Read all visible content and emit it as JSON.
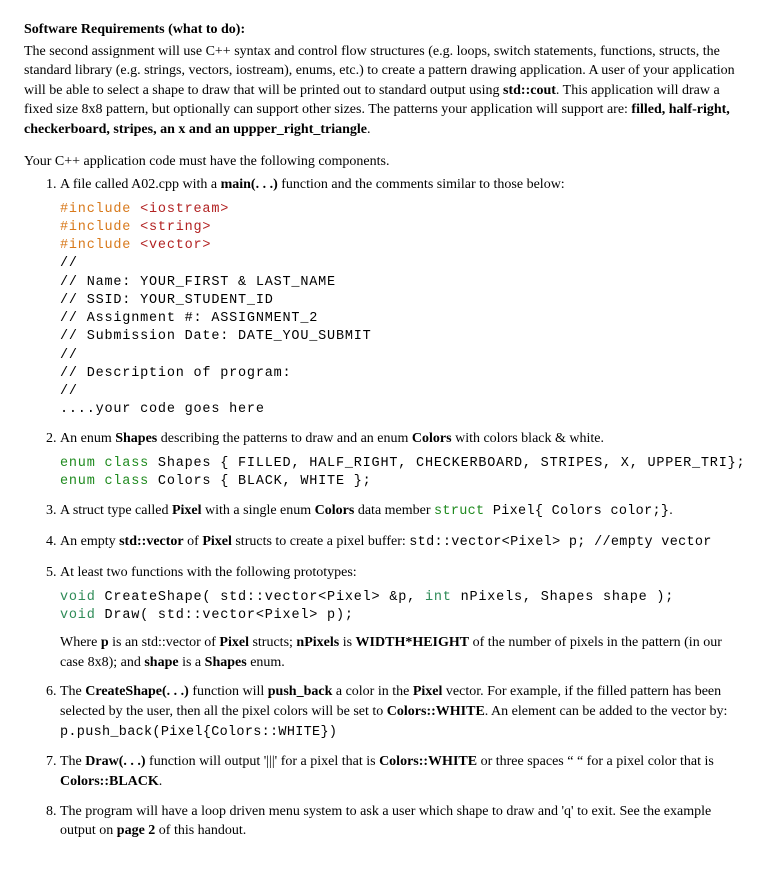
{
  "heading": "Software Requirements (what to do):",
  "intro_html": "The second assignment will use C++ syntax and control flow structures (e.g. loops, switch statements, functions, structs, the standard library (e.g. strings, vectors, iostream), enums, etc.) to create a pattern drawing application. A user of your application will be able to select a shape to draw that will be printed out to standard output using <b>std::cout</b>. This application will draw a fixed size 8x8 pattern, but optionally can support other sizes. The patterns your application will support are: <b>filled, half-right, checkerboard, stripes, an x and an uppper_right_triangle</b>.",
  "lead_in": "Your C++ application code must have the following components.",
  "item1_text_html": "A file called A02.cpp with a <b>main(. . .)</b> function and the comments similar to those below:",
  "code1_lines": {
    "l1a": "#include ",
    "l1b": "<iostream>",
    "l2a": "#include ",
    "l2b": "<string>",
    "l3a": "#include ",
    "l3b": "<vector>",
    "l4": "//",
    "l5": "// Name: YOUR_FIRST & LAST_NAME",
    "l6": "// SSID: YOUR_STUDENT_ID",
    "l7": "// Assignment #: ASSIGNMENT_2",
    "l8": "// Submission Date: DATE_YOU_SUBMIT",
    "l9": "//",
    "l10": "// Description of program:",
    "l11": "//",
    "l12": "....your code goes here"
  },
  "item2_text_html": "An enum <b>Shapes</b> describing the patterns to draw and an enum <b>Colors</b> with colors black &amp; white.",
  "code2_lines": {
    "kw1": "enum class ",
    "body1": "Shapes { FILLED, HALF_RIGHT, CHECKERBOARD, STRIPES, X, UPPER_TRI};",
    "kw2": "enum class ",
    "body2": "Colors { BLACK, WHITE };"
  },
  "item3_text_html": "A struct type called <b>Pixel</b> with a single enum <b>Colors</b> data member <span class='inline-code'><span class='kw-type'>struct</span> Pixel{ Colors color;}</span>.",
  "item4_text_html": "An empty <b>std::vector</b> of <b>Pixel</b> structs to create a pixel buffer: <span class='inline-code'>std::vector&lt;Pixel&gt; p; //empty vector</span>",
  "item5_text_html": "At least two functions with the following prototypes:",
  "code5_lines": {
    "v1": "void ",
    "l1": "CreateShape( std::vector<Pixel> &p, ",
    "i1": "int ",
    "l1b": "nPixels, Shapes shape );",
    "v2": "void ",
    "l2": "Draw( std::vector<Pixel> p);"
  },
  "item5_note_html": "Where <b>p</b> is an std::vector of <b>Pixel</b> structs; <b>nPixels</b> is <b>WIDTH*HEIGHT</b> of the number of pixels in the pattern (in our case 8x8); and <b>shape</b> is a <b>Shapes</b> enum.",
  "item6_text_html": "The <b>CreateShape(. . .)</b> function will <b>push_back</b> a color in the <b>Pixel</b> vector. For example, if the filled pattern has been selected by the user, then all the pixel colors will be set to <b>Colors::WHITE</b>. An element can be added to the vector by: <span class='inline-code'>p.push_back(Pixel{Colors::WHITE})</span>",
  "item7_text_html": "The <b>Draw(. . .)</b> function will output '|||' for a pixel that is <b>Colors::WHITE</b> or three spaces &ldquo; &ldquo; for a pixel color that is <b>Colors::BLACK</b>.",
  "item8_text_html": "The program will have a loop driven menu system to ask a user which shape to draw and 'q' to exit. See the example output on <b>page 2</b> of this handout."
}
